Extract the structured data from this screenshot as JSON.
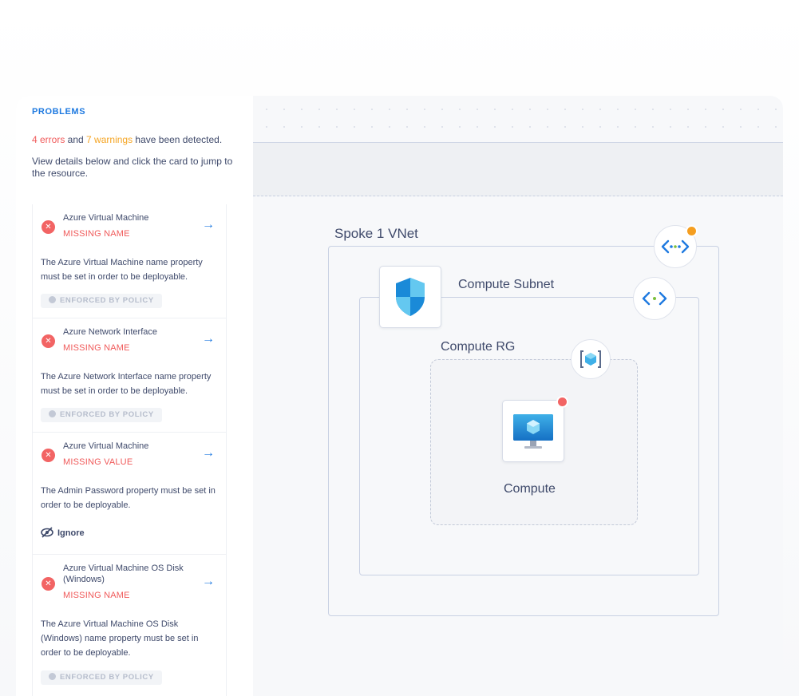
{
  "problems": {
    "title": "PROBLEMS",
    "summary": {
      "errors": "4 errors",
      "and": " and ",
      "warnings": "7 warnings",
      "tail": " have been detected."
    },
    "hint": "View details below and click the card to jump to the resource.",
    "cards": [
      {
        "title": "Azure Virtual Machine",
        "status": "MISSING NAME",
        "description": "The Azure Virtual Machine name property must be set in order to be deployable.",
        "badge": "ENFORCED BY POLICY"
      },
      {
        "title": "Azure Network Interface",
        "status": "MISSING NAME",
        "description": "The Azure Network Interface name property must be set in order to be deployable.",
        "badge": "ENFORCED BY POLICY"
      },
      {
        "title": "Azure Virtual Machine",
        "status": "MISSING VALUE",
        "description": "The Admin Password property must be set in order to be deployable.",
        "action": "Ignore"
      },
      {
        "title": "Azure Virtual Machine OS Disk (Windows)",
        "status": "MISSING NAME",
        "description": "The Azure Virtual Machine OS Disk (Windows) name property must be set in order to be deployable.",
        "badge": "ENFORCED BY POLICY"
      }
    ]
  },
  "diagram": {
    "vnet_label": "Spoke 1 VNet",
    "subnet_label": "Compute Subnet",
    "rg_label": "Compute RG",
    "compute_label": "Compute"
  },
  "colors": {
    "accent": "#1f7ae0",
    "error": "#f05a5a",
    "warning": "#f5a524"
  },
  "icons": [
    "error-icon",
    "arrow-right-icon",
    "shield-check-icon",
    "eye-slash-icon",
    "vnet-icon",
    "subnet-icon",
    "nsg-shield-icon",
    "resource-group-icon",
    "virtual-machine-icon"
  ]
}
